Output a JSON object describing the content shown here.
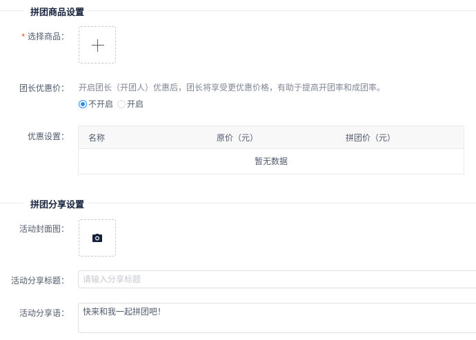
{
  "section_goods": {
    "title": "拼团商品设置"
  },
  "select_goods": {
    "required_mark": "*",
    "label": "选择商品："
  },
  "leader_discount": {
    "label": "团长优惠价：",
    "hint": "开启团长（开团人）优惠后，团长将享受更优惠价格，有助于提高开团率和成团率。",
    "options": [
      {
        "label": "不开启",
        "checked": true
      },
      {
        "label": "开启",
        "checked": false
      }
    ]
  },
  "discount_settings": {
    "label": "优惠设置：",
    "columns": [
      "名称",
      "原价（元）",
      "拼团价（元）"
    ],
    "empty_text": "暂无数据"
  },
  "section_share": {
    "title": "拼团分享设置"
  },
  "cover_image": {
    "label": "活动封面图："
  },
  "share_title": {
    "label": "活动分享标题：",
    "placeholder": "请输入分享标题",
    "value": ""
  },
  "share_text": {
    "label": "活动分享语：",
    "value": "快来和我一起拼团吧！"
  },
  "colors": {
    "primary": "#2d8cf0",
    "required": "#ed4014",
    "border": "#dcdee2"
  },
  "icons": {
    "add": "plus-icon",
    "camera": "camera-icon"
  }
}
